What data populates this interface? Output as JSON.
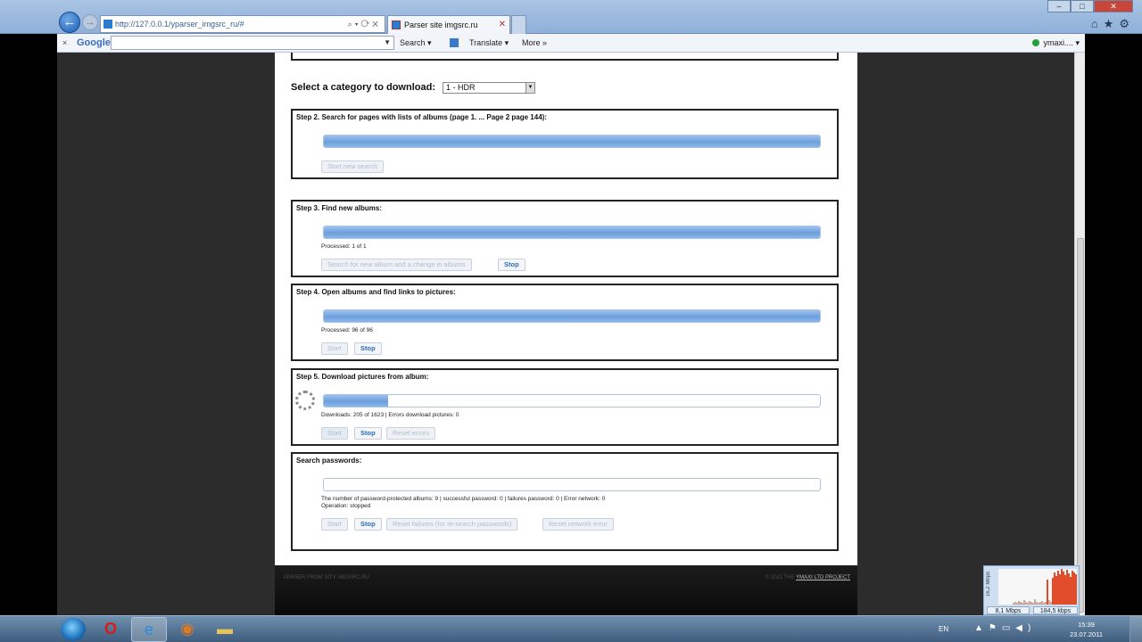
{
  "browser": {
    "address": "http://127.0.0.1/yparser_imgsrc_ru/#",
    "tab_title": "Parser site imgsrc.ru",
    "nav_back": "←",
    "nav_forward": "→",
    "window_controls": [
      "–",
      "□",
      "✕"
    ],
    "right_icons": "⌂★⚙"
  },
  "toolbar": {
    "close": "×",
    "google": "Google",
    "search": "Search ▾",
    "translate": "Translate ▾",
    "more": "More »",
    "user": "ymaxi.... ▾"
  },
  "page": {
    "category_label": "Select a category to download:",
    "category_value": "1 - HDR",
    "steps": {
      "step2": {
        "title": "Step 2. Search for pages with lists of albums (page 1. ... Page 2 page 144):",
        "progress": 1.0,
        "btn_start": "Start new search"
      },
      "step3": {
        "title": "Step 3. Find new albums:",
        "progress": 1.0,
        "status": "Processed: 1 of 1",
        "btn_search": "Search for new album and a change in albums",
        "btn_stop": "Stop"
      },
      "step4": {
        "title": "Step 4. Open albums and find links to pictures:",
        "progress": 1.0,
        "status": "Processed: 96 of 96",
        "btn_start": "Start",
        "btn_stop": "Stop"
      },
      "step5": {
        "title": "Step 5. Download pictures from album:",
        "progress": 0.13,
        "status": "Downloads: 205 of 1623 | Errors download pictures: 0",
        "btn_start": "Start",
        "btn_stop": "Stop",
        "btn_reset": "Reset  errors"
      },
      "passwords": {
        "title": "Search passwords:",
        "progress": 0.0,
        "status1": "The number of password-protected albums: 9 | successful password: 0 | failures password: 0 | Error network: 0",
        "status2": "Operation: stopped",
        "btn_start": "Start",
        "btn_stop": "Stop",
        "btn_reset_failures": "Reset failures (for re-search passwords)",
        "btn_reset_network": "Reset network error"
      }
    },
    "footer_left": "PARSER FROM SITY: IMGSRC.RU",
    "footer_right_prefix": "© 2011 THE",
    "footer_right_link": "YMAXI LTD PROJECT"
  },
  "gadget": {
    "axis": "16,2 Mbps",
    "down": "8,1 Mbps",
    "up": "184,5 kbps"
  },
  "taskbar": {
    "lang": "EN",
    "tray_icons": "▲⚑▭◀)",
    "time": "15:39",
    "date": "23.07.2011"
  },
  "colors": {
    "progress_fill": "#7aa8e0",
    "active_button_text": "#2e6bb5",
    "page_background": "#ffffff",
    "outer_background": "#2c2c2c"
  }
}
